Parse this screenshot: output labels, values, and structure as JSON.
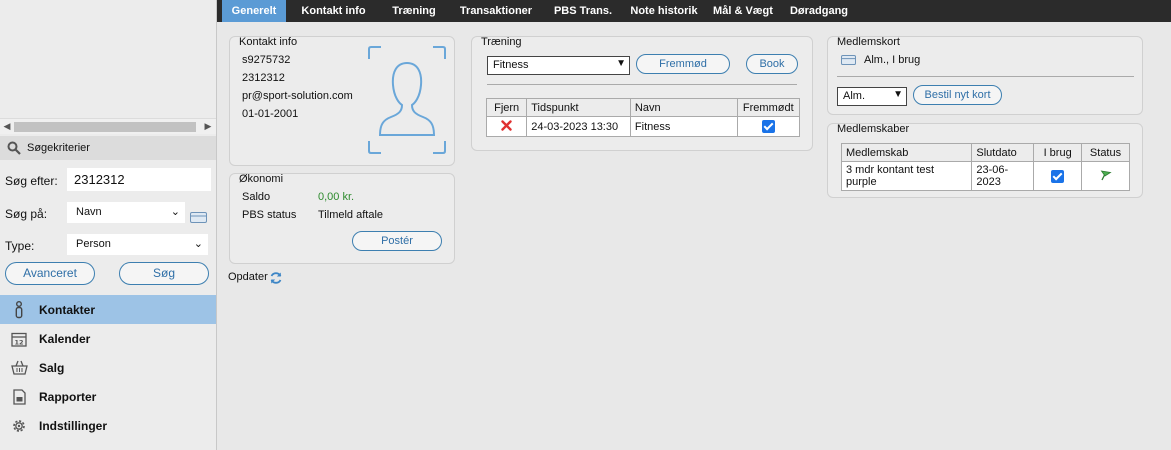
{
  "sidebar": {
    "search_header": "Søgekriterier",
    "search_for_label": "Søg efter:",
    "search_for_value": "2312312",
    "search_on_label": "Søg på:",
    "search_on_value": "Navn",
    "type_label": "Type:",
    "type_value": "Person",
    "advanced_button": "Avanceret",
    "search_button": "Søg",
    "nav": [
      {
        "label": "Kontakter",
        "icon": "person-icon",
        "active": true
      },
      {
        "label": "Kalender",
        "icon": "calendar-icon",
        "active": false
      },
      {
        "label": "Salg",
        "icon": "basket-icon",
        "active": false
      },
      {
        "label": "Rapporter",
        "icon": "report-icon",
        "active": false
      },
      {
        "label": "Indstillinger",
        "icon": "gear-icon",
        "active": false
      }
    ]
  },
  "tabs": [
    "Generelt",
    "Kontakt info",
    "Træning",
    "Transaktioner",
    "PBS Trans.",
    "Note historik",
    "Mål & Vægt",
    "Døradgang"
  ],
  "contact": {
    "title": "Kontakt info",
    "line1": "s9275732",
    "line2": "2312312",
    "line3": "pr@sport-solution.com",
    "line4": "01-01-2001"
  },
  "economy": {
    "title": "Økonomi",
    "balance_label": "Saldo",
    "balance_value": "0,00 kr.",
    "pbs_label": "PBS status",
    "pbs_value": "Tilmeld aftale",
    "post_button": "Postér"
  },
  "update_label": "Opdater",
  "training": {
    "title": "Træning",
    "select_value": "Fitness",
    "attend_button": "Fremmød",
    "book_button": "Book",
    "columns": [
      "Fjern",
      "Tidspunkt",
      "Navn",
      "Fremmødt"
    ],
    "rows": [
      {
        "time": "24-03-2023 13:30",
        "name": "Fitness"
      }
    ]
  },
  "cards": {
    "title": "Medlemskort",
    "card_text": "Alm., I brug",
    "select_value": "Alm.",
    "order_button": "Bestil nyt kort"
  },
  "memberships": {
    "title": "Medlemskaber",
    "columns": [
      "Medlemskab",
      "Slutdato",
      "I brug",
      "Status"
    ],
    "rows": [
      {
        "name": "3 mdr kontant test purple",
        "end": "23-06-2023"
      }
    ]
  },
  "colors": {
    "accent": "#5b9bd5",
    "nav_active": "#9dc3e6",
    "balance_green": "#2e8b2e",
    "remove_red": "#e03030"
  }
}
